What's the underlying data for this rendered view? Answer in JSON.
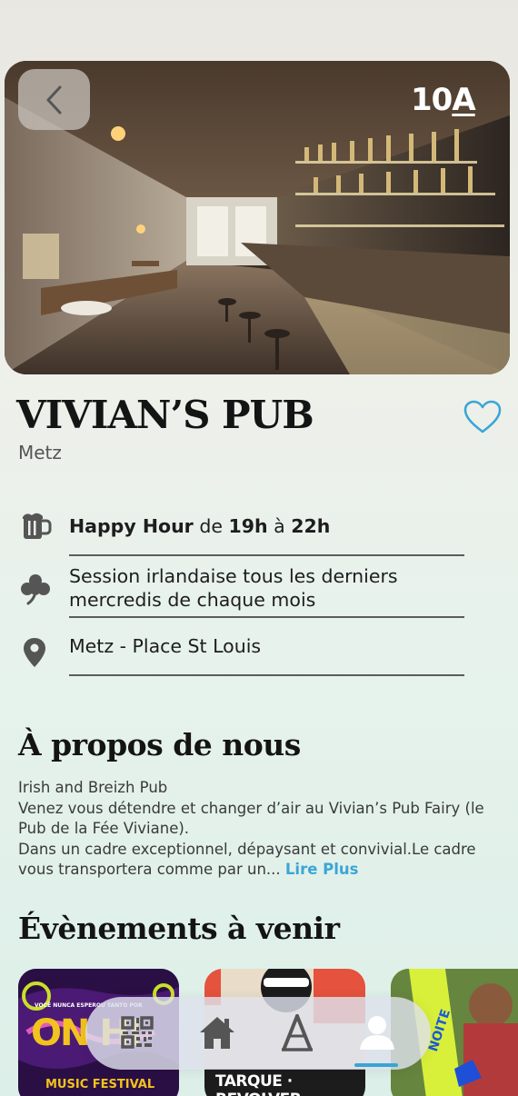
{
  "header": {
    "age_badge_number": "10",
    "age_badge_letter": "A"
  },
  "venue": {
    "name": "VIVIAN’S PUB",
    "city": "Metz"
  },
  "info": {
    "happy_hour_label": "Happy Hour",
    "happy_hour_from": "de",
    "happy_hour_start": "19h",
    "happy_hour_to": "à",
    "happy_hour_end": "22h",
    "session": "Session irlandaise tous les derniers mercredis de chaque mois",
    "address": "Metz - Place St Louis"
  },
  "about": {
    "title": "À propos de nous",
    "line1": "Irish and Breizh Pub",
    "line2": "Venez vous détendre et changer d’air au Vivian’s Pub Fairy (le Pub de la Fée Viviane).",
    "line3": "Dans un cadre exceptionnel, dépaysant et convivial.Le cadre vous transportera comme par un...",
    "read_more": "Lire Plus"
  },
  "events": {
    "title": "Évènements à venir",
    "cards": [
      {
        "top": "VOCÊ NUNCA ESPEROU TANTO POR",
        "headline": "ON HI",
        "sub": "MUSIC FESTIVAL"
      },
      {
        "headline": "TARQUE · REVOLVER"
      },
      {
        "headline": "NOITE"
      }
    ]
  },
  "colors": {
    "accent": "#39a4d6",
    "text": "#1d1d1d",
    "divider": "#5c5c5c"
  },
  "icons": [
    "chevron-left-icon",
    "heart-icon",
    "beer-mug-icon",
    "shamrock-icon",
    "map-pin-icon",
    "qr-code-icon",
    "home-icon",
    "a-icon",
    "user-icon"
  ]
}
